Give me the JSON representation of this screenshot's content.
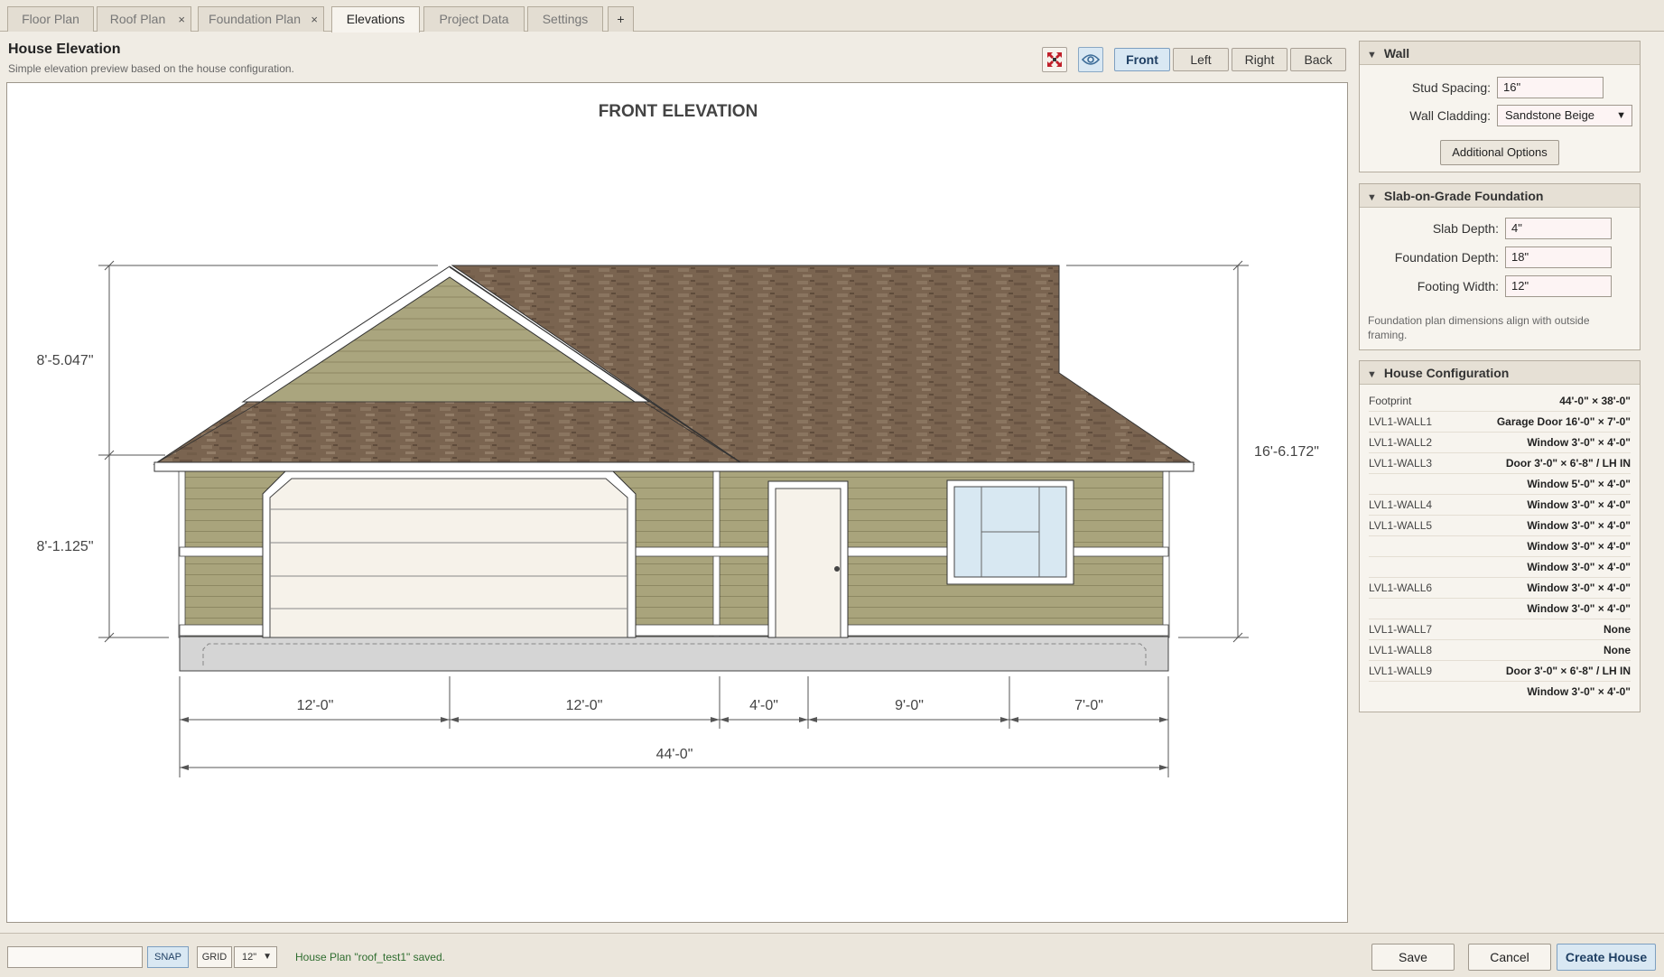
{
  "tabs": [
    {
      "label": "Floor Plan",
      "active": false,
      "closable": false
    },
    {
      "label": "Roof Plan",
      "active": false,
      "closable": true
    },
    {
      "label": "Foundation Plan",
      "active": false,
      "closable": true
    },
    {
      "label": "Elevations",
      "active": true,
      "closable": false
    },
    {
      "label": "Project Data",
      "active": false,
      "closable": false
    },
    {
      "label": "Settings",
      "active": false,
      "closable": false
    }
  ],
  "add_tab_label": "+",
  "close_glyph": "×",
  "header": {
    "title": "House Elevation",
    "subtitle": "Simple elevation preview based on the house configuration."
  },
  "toolbar": {
    "icons": [
      "fit-view-icon",
      "eye-icon"
    ],
    "views": [
      "Front",
      "Left",
      "Right",
      "Back"
    ],
    "active_view": "Front"
  },
  "elevation": {
    "title": "FRONT ELEVATION",
    "dims": {
      "upper_height": "8'-5.047\"",
      "lower_height": "8'-1.125\"",
      "total_height": "16'-6.172\"",
      "segments": [
        "12'-0\"",
        "12'-0\"",
        "4'-0\"",
        "9'-0\"",
        "7'-0\""
      ],
      "total_width": "44'-0\""
    },
    "colors": {
      "siding": "#a9a47c",
      "gable_siding": "#aaa57e",
      "roof": "#7a6450",
      "trim": "#ffffff",
      "garage_door": "#f6f2ea",
      "door": "#f6f2ea",
      "window_glass": "#d8e8f2",
      "foundation": "#d5d5d5",
      "dimension_line": "#555555"
    }
  },
  "wall_panel": {
    "title": "Wall",
    "stud_spacing_label": "Stud Spacing:",
    "stud_spacing_value": "16\"",
    "wall_cladding_label": "Wall Cladding:",
    "wall_cladding_value": "Sandstone Beige",
    "additional_options_label": "Additional Options"
  },
  "foundation_panel": {
    "title": "Slab-on-Grade Foundation",
    "slab_depth_label": "Slab Depth:",
    "slab_depth_value": "4\"",
    "foundation_depth_label": "Foundation Depth:",
    "foundation_depth_value": "18\"",
    "footing_width_label": "Footing Width:",
    "footing_width_value": "12\"",
    "note": "Foundation plan dimensions align with outside framing."
  },
  "house_config": {
    "title": "House Configuration",
    "rows": [
      {
        "key": "Footprint",
        "value": "44'-0\" × 38'-0\""
      },
      {
        "key": "LVL1-WALL1",
        "value": "Garage Door 16'-0\" × 7'-0\""
      },
      {
        "key": "LVL1-WALL2",
        "value": "Window 3'-0\" × 4'-0\""
      },
      {
        "key": "LVL1-WALL3",
        "value": "Door 3'-0\" × 6'-8\" / LH IN"
      },
      {
        "key": "",
        "value": "Window 5'-0\" × 4'-0\""
      },
      {
        "key": "LVL1-WALL4",
        "value": "Window 3'-0\" × 4'-0\""
      },
      {
        "key": "LVL1-WALL5",
        "value": "Window 3'-0\" × 4'-0\""
      },
      {
        "key": "",
        "value": "Window 3'-0\" × 4'-0\""
      },
      {
        "key": "",
        "value": "Window 3'-0\" × 4'-0\""
      },
      {
        "key": "LVL1-WALL6",
        "value": "Window 3'-0\" × 4'-0\""
      },
      {
        "key": "",
        "value": "Window 3'-0\" × 4'-0\""
      },
      {
        "key": "LVL1-WALL7",
        "value": "None"
      },
      {
        "key": "LVL1-WALL8",
        "value": "None"
      },
      {
        "key": "LVL1-WALL9",
        "value": "Door 3'-0\" × 6'-8\" / LH IN"
      },
      {
        "key": "",
        "value": "Window 3'-0\" × 4'-0\""
      }
    ]
  },
  "footer": {
    "command_value": "",
    "snap_label": "SNAP",
    "grid_label": "GRID",
    "grid_value": "12\"",
    "status": "House Plan \"roof_test1\" saved.",
    "save_label": "Save",
    "cancel_label": "Cancel",
    "create_label": "Create House"
  }
}
